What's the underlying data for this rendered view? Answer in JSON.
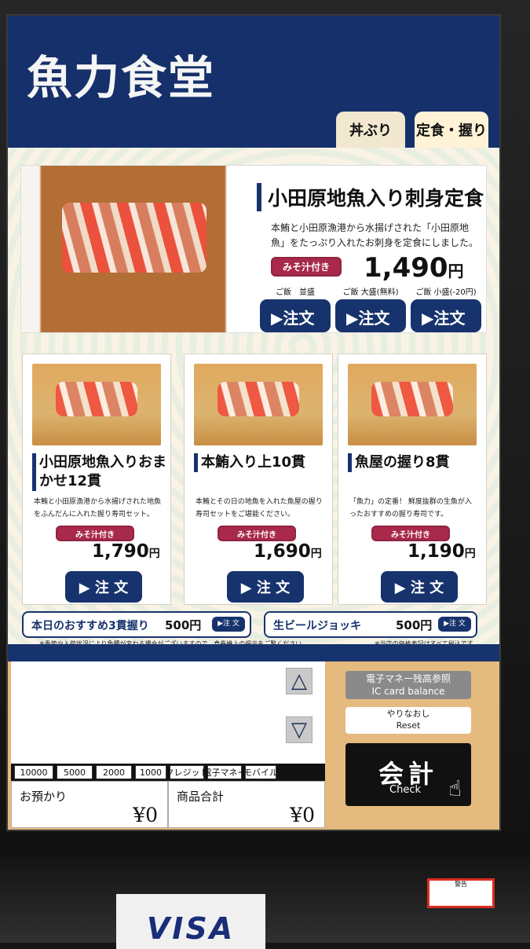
{
  "header": {
    "title": "魚力食堂"
  },
  "tabs": [
    {
      "label": "丼ぶり"
    },
    {
      "label": "定食・握り"
    }
  ],
  "featured": {
    "title": "小田原地魚入り刺身定食",
    "description": "本鮪と小田原漁港から水揚げされた「小田原地魚」をたっぷり入れたお刺身を定食にしました。",
    "miso": "みそ汁付き",
    "price": "1,490",
    "yen": "円",
    "options": [
      {
        "label": "ご飯　並盛",
        "button": "▶注文"
      },
      {
        "label": "ご飯 大盛(無料)",
        "button": "▶注文"
      },
      {
        "label": "ご飯 小盛(-20円)",
        "button": "▶注文"
      }
    ]
  },
  "cards": [
    {
      "title": "小田原地魚入りおまかせ12貫",
      "description": "本鮪と小田原漁港から水揚げされた地魚をふんだんに入れた握り寿司セット。",
      "miso": "みそ汁付き",
      "price": "1,790",
      "yen": "円",
      "button": "▶ 注 文"
    },
    {
      "title": "本鮪入り上10貫",
      "description": "本鮪とその日の地魚を入れた魚屋の握り寿司セットをご堪能ください。",
      "miso": "みそ汁付き",
      "price": "1,690",
      "yen": "円",
      "button": "▶ 注 文"
    },
    {
      "title": "魚屋の握り8貫",
      "description": "「魚力」の定番！ 鮮度抜群の生魚が入ったおすすめの握り寿司です。",
      "miso": "みそ汁付き",
      "price": "1,190",
      "yen": "円",
      "button": "▶ 注 文"
    }
  ],
  "strips": [
    {
      "title": "本日のおすすめ3貫握り",
      "price": "500円",
      "button": "▶注 文"
    },
    {
      "title": "生ビールジョッキ",
      "price": "500円",
      "button": "▶注 文"
    }
  ],
  "notes": {
    "left": "※季節や入荷状況により魚種が変わる場合がございますので、食券機上の掲示をご覧ください。",
    "right": "※当店の価格表記はすべて税込です。"
  },
  "controls": {
    "cash_buttons": [
      "10000",
      "5000",
      "2000",
      "1000",
      "クレジット",
      "電子マネー",
      "モバイル"
    ],
    "deposit_label": "お預かり",
    "deposit_value": "¥0",
    "total_label": "商品合計",
    "total_value": "¥0",
    "balance_jp": "電子マネー残高参照",
    "balance_en": "IC card balance",
    "reset_jp": "やりなおし",
    "reset_en": "Reset",
    "check_jp": "会計",
    "check_en": "Check"
  },
  "device": {
    "visa": "VISA",
    "warning": "警告"
  }
}
